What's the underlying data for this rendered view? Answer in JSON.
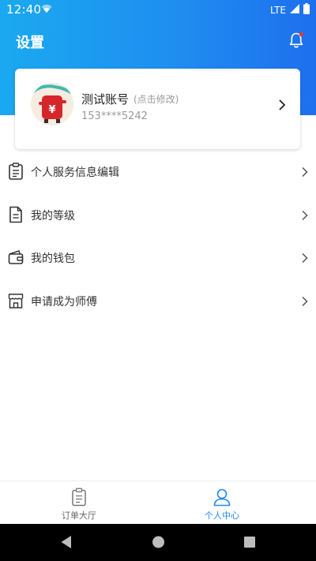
{
  "status_bar": {
    "time": "12:40",
    "network": "LTE"
  },
  "header": {
    "title": "设置"
  },
  "profile": {
    "name": "测试账号",
    "edit_hint": "(点击修改)",
    "phone": "153****5242",
    "avatar_icon": "red-wallet-mascot-icon"
  },
  "menu": {
    "items": [
      {
        "label": "个人服务信息编辑",
        "icon": "clipboard-icon"
      },
      {
        "label": "我的等级",
        "icon": "document-icon"
      },
      {
        "label": "我的钱包",
        "icon": "wallet-icon"
      },
      {
        "label": "申请成为师傅",
        "icon": "shop-icon"
      }
    ]
  },
  "tabs": [
    {
      "label": "订单大厅",
      "icon": "clipboard-icon",
      "active": false
    },
    {
      "label": "个人中心",
      "icon": "person-icon",
      "active": true
    }
  ],
  "colors": {
    "brand_blue": "#1e88ee",
    "active_tab": "#1e88ee",
    "inactive_tab": "#666666",
    "notification_dot": "#e53935"
  }
}
